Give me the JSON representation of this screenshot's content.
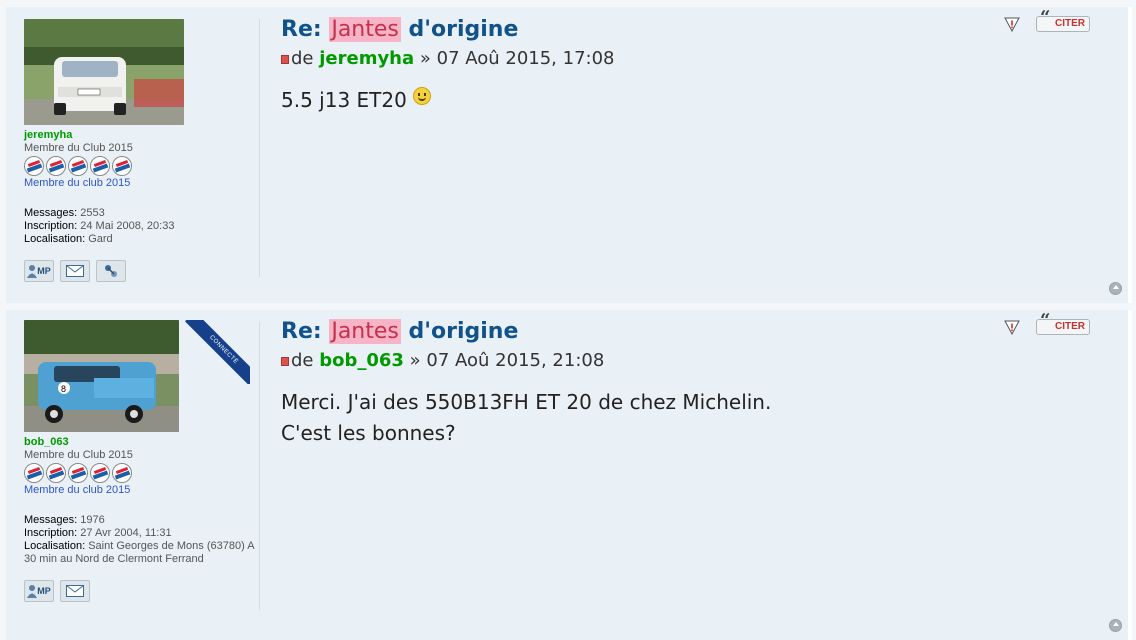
{
  "posts": [
    {
      "title_prefix": "Re: ",
      "title_highlight": "Jantes",
      "title_suffix": " d'origine",
      "author_prefix": "de ",
      "author": "jeremyha",
      "date": " » 07 Aoû 2015, 17:08",
      "body_lines": [
        "5.5 j13 ET20"
      ],
      "has_smiley": true,
      "profile": {
        "username": "jeremyha",
        "rank": "Membre du Club 2015",
        "badge_text": "Membre du club 2015",
        "messages_label": "Messages:",
        "messages": "2553",
        "inscription_label": "Inscription:",
        "inscription": "24 Mai 2008, 20:33",
        "localisation_label": "Localisation:",
        "localisation": "Gard",
        "online_ribbon": ""
      },
      "buttons": {
        "citer": "CITER",
        "mp": "MP"
      }
    },
    {
      "title_prefix": "Re: ",
      "title_highlight": "Jantes",
      "title_suffix": " d'origine",
      "author_prefix": "de ",
      "author": "bob_063",
      "date": " » 07 Aoû 2015, 21:08",
      "body_lines": [
        "Merci. J'ai des 550B13FH ET 20 de chez Michelin.",
        "C'est les bonnes?"
      ],
      "has_smiley": false,
      "profile": {
        "username": "bob_063",
        "rank": "Membre du Club 2015",
        "badge_text": "Membre du club 2015",
        "messages_label": "Messages:",
        "messages": "1976",
        "inscription_label": "Inscription:",
        "inscription": "27 Avr 2004, 11:31",
        "localisation_label": "Localisation:",
        "localisation": "Saint Georges de Mons (63780) A 30 min au Nord de Clermont Ferrand",
        "online_ribbon": "CONNECTÉ"
      },
      "buttons": {
        "citer": "CITER",
        "mp": "MP"
      }
    }
  ],
  "colors": {
    "title": "#105289",
    "username": "#009900",
    "highlight_bg": "#f7b4c7",
    "post_bg": "#e9f1f6"
  }
}
